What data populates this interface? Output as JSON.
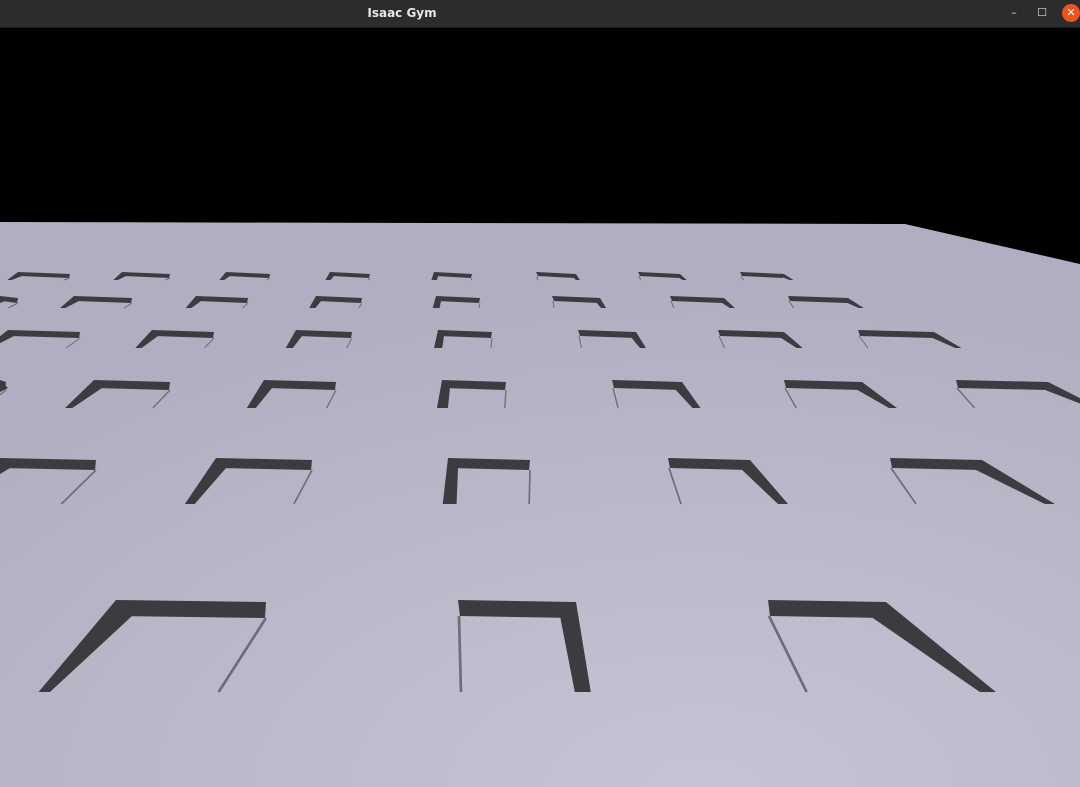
{
  "window": {
    "title": "Isaac Gym",
    "minimize_glyph": "–",
    "maximize_glyph": "☐",
    "close_glyph": "✕"
  },
  "scene": {
    "sky_color": "#000000",
    "ground_color": "#b3b1c3",
    "ground_highlight": "#c6c4d4",
    "hole_color": "#3b3b40",
    "hole_shadow": "#2a2a2e",
    "hole_side_light": "#6d6c78",
    "accent_close": "#e95420"
  }
}
